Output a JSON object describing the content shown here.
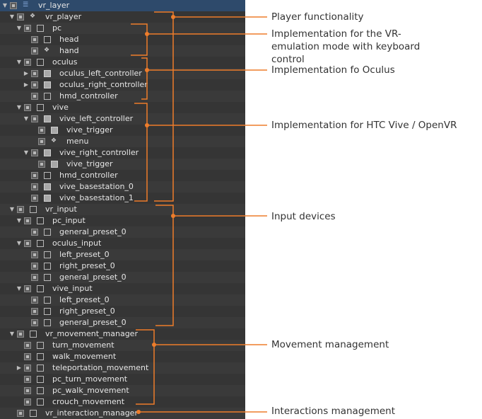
{
  "colors": {
    "accent": "#ee7d2b",
    "tree_bg": "#3a3a3a",
    "tree_text": "#e6e6e6",
    "annotation_text": "#333333"
  },
  "tree": [
    {
      "label": "vr_layer",
      "depth": 0,
      "arrow": "down",
      "icon": "layer",
      "selected": true
    },
    {
      "label": "vr_player",
      "depth": 1,
      "arrow": "down",
      "icon": "ref"
    },
    {
      "label": "pc",
      "depth": 2,
      "arrow": "down",
      "icon": "empty"
    },
    {
      "label": "head",
      "depth": 3,
      "arrow": "",
      "icon": "empty"
    },
    {
      "label": "hand",
      "depth": 3,
      "arrow": "",
      "icon": "ref"
    },
    {
      "label": "oculus",
      "depth": 2,
      "arrow": "down",
      "icon": "empty"
    },
    {
      "label": "oculus_left_controller",
      "depth": 3,
      "arrow": "right",
      "icon": "filled"
    },
    {
      "label": "oculus_right_controller",
      "depth": 3,
      "arrow": "right",
      "icon": "filled"
    },
    {
      "label": "hmd_controller",
      "depth": 3,
      "arrow": "",
      "icon": "empty"
    },
    {
      "label": "vive",
      "depth": 2,
      "arrow": "down",
      "icon": "empty"
    },
    {
      "label": "vive_left_controller",
      "depth": 3,
      "arrow": "down",
      "icon": "filled"
    },
    {
      "label": "vive_trigger",
      "depth": 4,
      "arrow": "",
      "icon": "filled"
    },
    {
      "label": "menu",
      "depth": 4,
      "arrow": "",
      "icon": "ref"
    },
    {
      "label": "vive_right_controller",
      "depth": 3,
      "arrow": "down",
      "icon": "filled"
    },
    {
      "label": "vive_trigger",
      "depth": 4,
      "arrow": "",
      "icon": "filled"
    },
    {
      "label": "hmd_controller",
      "depth": 3,
      "arrow": "",
      "icon": "empty"
    },
    {
      "label": "vive_basestation_0",
      "depth": 3,
      "arrow": "",
      "icon": "filled"
    },
    {
      "label": "vive_basestation_1",
      "depth": 3,
      "arrow": "",
      "icon": "filled"
    },
    {
      "label": "vr_input",
      "depth": 1,
      "arrow": "down",
      "icon": "empty"
    },
    {
      "label": "pc_input",
      "depth": 2,
      "arrow": "down",
      "icon": "empty"
    },
    {
      "label": "general_preset_0",
      "depth": 3,
      "arrow": "",
      "icon": "empty"
    },
    {
      "label": "oculus_input",
      "depth": 2,
      "arrow": "down",
      "icon": "empty"
    },
    {
      "label": "left_preset_0",
      "depth": 3,
      "arrow": "",
      "icon": "empty"
    },
    {
      "label": "right_preset_0",
      "depth": 3,
      "arrow": "",
      "icon": "empty"
    },
    {
      "label": "general_preset_0",
      "depth": 3,
      "arrow": "",
      "icon": "empty"
    },
    {
      "label": "vive_input",
      "depth": 2,
      "arrow": "down",
      "icon": "empty"
    },
    {
      "label": "left_preset_0",
      "depth": 3,
      "arrow": "",
      "icon": "empty"
    },
    {
      "label": "right_preset_0",
      "depth": 3,
      "arrow": "",
      "icon": "empty"
    },
    {
      "label": "general_preset_0",
      "depth": 3,
      "arrow": "",
      "icon": "empty"
    },
    {
      "label": "vr_movement_manager",
      "depth": 1,
      "arrow": "down",
      "icon": "empty"
    },
    {
      "label": "turn_movement",
      "depth": 2,
      "arrow": "",
      "icon": "empty"
    },
    {
      "label": "walk_movement",
      "depth": 2,
      "arrow": "",
      "icon": "empty"
    },
    {
      "label": "teleportation_movement",
      "depth": 2,
      "arrow": "right",
      "icon": "empty"
    },
    {
      "label": "pc_turn_movement",
      "depth": 2,
      "arrow": "",
      "icon": "empty"
    },
    {
      "label": "pc_walk_movement",
      "depth": 2,
      "arrow": "",
      "icon": "empty"
    },
    {
      "label": "crouch_movement",
      "depth": 2,
      "arrow": "",
      "icon": "empty"
    },
    {
      "label": "vr_interaction_manager",
      "depth": 1,
      "arrow": "",
      "icon": "empty"
    }
  ],
  "annotations": [
    {
      "id": "player",
      "text": "Player functionality"
    },
    {
      "id": "pc",
      "text": "Implementation for the VR-emulation mode with keyboard control"
    },
    {
      "id": "oculus",
      "text": "Implementation fo Oculus"
    },
    {
      "id": "vive",
      "text": "Implementation for HTC Vive / OpenVR"
    },
    {
      "id": "input",
      "text": "Input devices"
    },
    {
      "id": "movement",
      "text": "Movement management"
    },
    {
      "id": "interaction",
      "text": "Interactions management"
    }
  ]
}
